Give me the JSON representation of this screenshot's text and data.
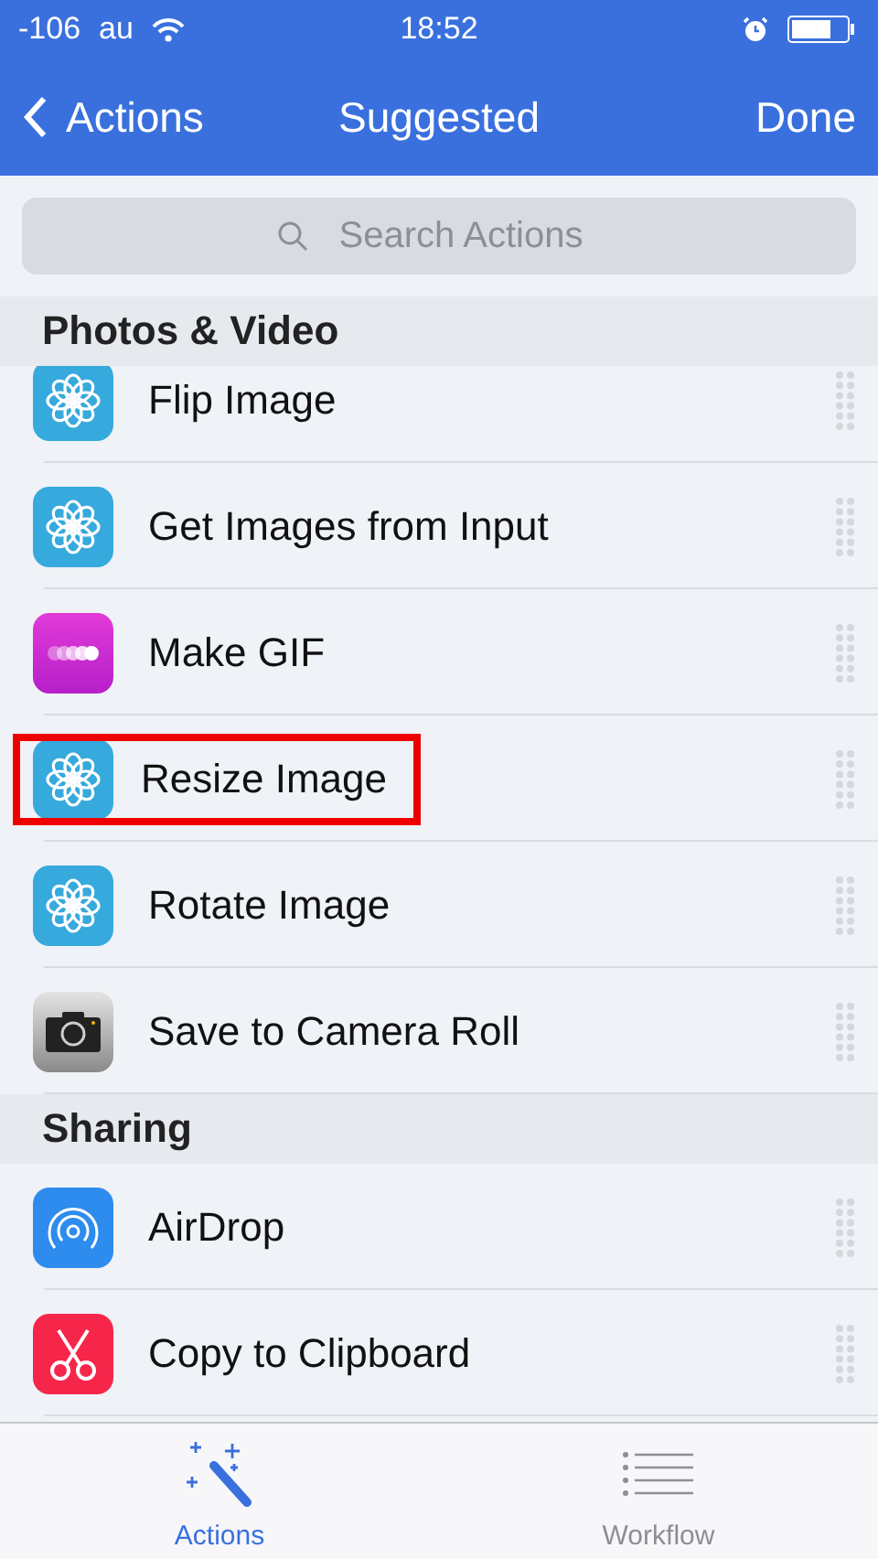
{
  "status_bar": {
    "signal": "-106",
    "carrier": "au",
    "time": "18:52"
  },
  "nav": {
    "back": "Actions",
    "title": "Suggested",
    "done": "Done"
  },
  "search": {
    "placeholder": "Search Actions"
  },
  "sections": [
    {
      "title": "Photos & Video",
      "items": [
        {
          "label": "Flip Image",
          "kind": "photos",
          "highlighted": false
        },
        {
          "label": "Get Images from Input",
          "kind": "photos",
          "highlighted": false
        },
        {
          "label": "Make GIF",
          "kind": "gif",
          "highlighted": false
        },
        {
          "label": "Resize Image",
          "kind": "photos",
          "highlighted": true
        },
        {
          "label": "Rotate Image",
          "kind": "photos",
          "highlighted": false
        },
        {
          "label": "Save to Camera Roll",
          "kind": "camera",
          "highlighted": false
        }
      ]
    },
    {
      "title": "Sharing",
      "items": [
        {
          "label": "AirDrop",
          "kind": "airdrop",
          "highlighted": false
        },
        {
          "label": "Copy to Clipboard",
          "kind": "clipboard",
          "highlighted": false
        }
      ]
    }
  ],
  "tabs": [
    {
      "label": "Actions",
      "kind": "actions",
      "selected": true
    },
    {
      "label": "Workflow",
      "kind": "workflow",
      "selected": false
    }
  ]
}
